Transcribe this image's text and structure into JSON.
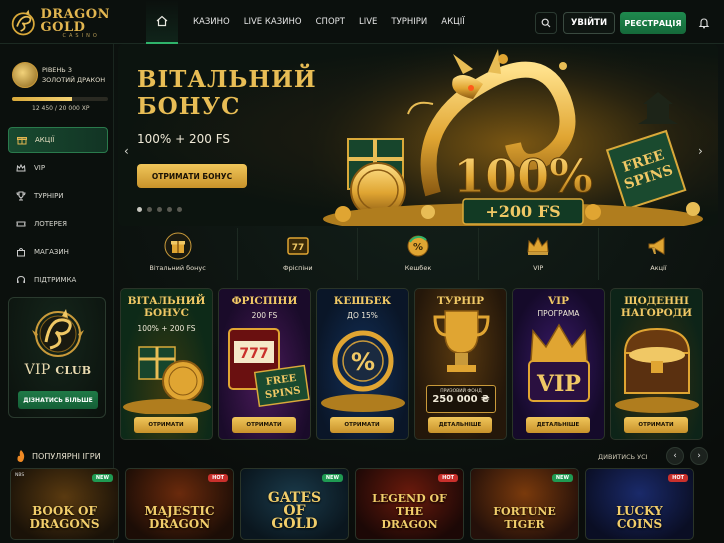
{
  "brand": {
    "line1": "DRAGON",
    "line2": "GOLD",
    "line3": "CASINO"
  },
  "nav": {
    "items": [
      "КАЗИНО",
      "LIVE КАЗИНО",
      "СПОРТ",
      "LIVE",
      "ТУРНІРИ",
      "АКЦІЇ"
    ]
  },
  "header": {
    "login_label": "УВІЙТИ",
    "register_label": "РЕЄСТРАЦІЯ"
  },
  "profile": {
    "level": "РІВЕНЬ 3",
    "rank": "ЗОЛОТИЙ ДРАКОН",
    "xp_text": "12 450 / 20 000 XP",
    "xp_progress": 0.6225
  },
  "sidebar": {
    "items": [
      {
        "label": "АКЦІЇ",
        "icon": "gift-icon",
        "active": true
      },
      {
        "label": "VIP",
        "icon": "crown-icon",
        "active": false
      },
      {
        "label": "ТУРНІРИ",
        "icon": "trophy-icon",
        "active": false
      },
      {
        "label": "ЛОТЕРЕЯ",
        "icon": "ticket-icon",
        "active": false
      },
      {
        "label": "МАГАЗИН",
        "icon": "bag-icon",
        "active": false
      },
      {
        "label": "ПІДТРИМКА",
        "icon": "headset-icon",
        "active": false
      }
    ]
  },
  "vip_club": {
    "title": "VIP",
    "title2": "CLUB",
    "button": "ДІЗНАТИСЬ БІЛЬШЕ"
  },
  "hero": {
    "title1": "ВІТАЛЬНИЙ",
    "title2": "БОНУС",
    "subtitle": "100% + 200 FS",
    "button": "ОТРИМАТИ БОНУС",
    "art_big": "100%",
    "art_fs": "+200 FS",
    "art_free": "FREE",
    "art_spins": "SPINS",
    "slides": 5,
    "active_slide": 1
  },
  "categories": [
    {
      "label": "Вітальний бонус",
      "icon": "gift-icon"
    },
    {
      "label": "Фріспіни",
      "icon": "slot-icon"
    },
    {
      "label": "Кешбек",
      "icon": "cashback-icon"
    },
    {
      "label": "VIP",
      "icon": "crown-icon"
    },
    {
      "label": "Акції",
      "icon": "megaphone-icon"
    }
  ],
  "promos": [
    {
      "title": "ВІТАЛЬНИЙ\nБОНУС",
      "sub": "100% + 200 FS",
      "button": "ОТРИМАТИ"
    },
    {
      "title": "ФРІСПІНИ",
      "sub": "200 FS",
      "extra1": "FREE",
      "extra2": "SPINS",
      "button": "ОТРИМАТИ"
    },
    {
      "title": "КЕШБЕК",
      "sub": "ДО 15%",
      "extra1": "%",
      "button": "ОТРИМАТИ"
    },
    {
      "title": "ТУРНІР",
      "sub": "",
      "extra1": "ПРИЗОВИЙ ФОНД",
      "extra2": "250 000 ₴",
      "button": "ДЕТАЛЬНІШЕ"
    },
    {
      "title": "VIP",
      "sub": "ПРОГРАМА",
      "extra1": "VIP",
      "button": "ДЕТАЛЬНІШЕ"
    },
    {
      "title": "ЩОДЕННІ\nНАГОРОДИ",
      "sub": "",
      "button": "ОТРИМАТИ"
    }
  ],
  "popular": {
    "title": "ПОПУЛЯРНІ ІГРИ",
    "see_all": "ДИВИТИСЬ УСІ"
  },
  "games": [
    {
      "title": "BOOK OF DRAGONS",
      "badge": "NEW",
      "provider": "NBS"
    },
    {
      "title": "MAJESTIC DRAGON",
      "badge": "HOT",
      "provider": ""
    },
    {
      "title": "GATES OF GOLD",
      "badge": "NEW",
      "provider": ""
    },
    {
      "title": "LEGEND OF THE DRAGON",
      "badge": "HOT",
      "provider": ""
    },
    {
      "title": "FORTUNE TIGER",
      "badge": "NEW",
      "provider": ""
    },
    {
      "title": "LUCKY COINS",
      "badge": "HOT",
      "provider": ""
    }
  ],
  "colors": {
    "accent_green": "#1f8a4e",
    "gold": "#e2b650",
    "badge_new": "#1f9a52",
    "badge_hot": "#c9302c"
  }
}
